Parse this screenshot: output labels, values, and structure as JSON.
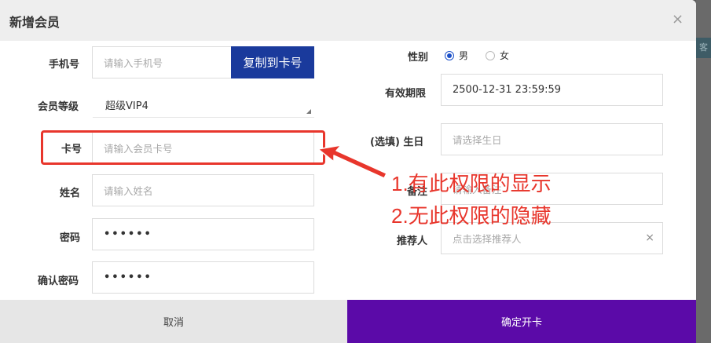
{
  "dialog": {
    "title": "新增会员",
    "close_icon": "×"
  },
  "side_tab": "客",
  "left": {
    "phone": {
      "label": "手机号",
      "placeholder": "请输入手机号",
      "copy_button": "复制到卡号"
    },
    "level": {
      "label": "会员等级",
      "value": "超级VIP4"
    },
    "card": {
      "label": "卡号",
      "placeholder": "请输入会员卡号"
    },
    "name": {
      "label": "姓名",
      "placeholder": "请输入姓名"
    },
    "password": {
      "label": "密码",
      "value": "••••••"
    },
    "confirm_password": {
      "label": "确认密码",
      "value": "••••••"
    }
  },
  "right": {
    "gender": {
      "label": "性别",
      "options": [
        "男",
        "女"
      ],
      "selected": "男"
    },
    "expiry": {
      "label": "有效期限",
      "value": "2500-12-31 23:59:59"
    },
    "birthday": {
      "label": "(选填) 生日",
      "placeholder": "请选择生日"
    },
    "remark": {
      "label": "备注",
      "placeholder": "请输入备注"
    },
    "referrer": {
      "label": "推荐人",
      "placeholder": "点击选择推荐人",
      "clear_icon": "×"
    }
  },
  "annotation": {
    "line1": "1.有此权限的显示",
    "line2": "2.无此权限的隐藏",
    "color": "#e8362c"
  },
  "footer": {
    "cancel": "取消",
    "confirm": "确定开卡",
    "confirm_color": "#5b0aa8"
  }
}
